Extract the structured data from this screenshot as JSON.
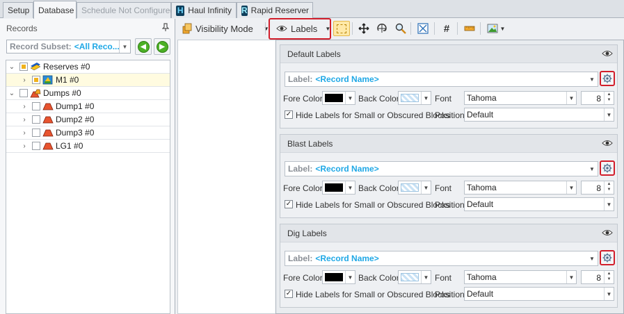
{
  "tabs": [
    {
      "label": "Setup"
    },
    {
      "label": "Database"
    },
    {
      "label": "Schedule Not Configured"
    },
    {
      "label": "Haul Infinity",
      "icon": "haul-infinity-icon"
    },
    {
      "label": "Rapid Reserver",
      "icon": "rapid-reserver-icon"
    }
  ],
  "records_panel": {
    "title": "Records",
    "subset_label": "Record Subset:",
    "subset_value": "<All Reco...",
    "tree": [
      {
        "label": "Reserves #0",
        "expanded": true,
        "checkbox": "partial",
        "icon": "reserves-icon"
      },
      {
        "label": "M1 #0",
        "checkbox": "partial",
        "icon": "model-icon"
      },
      {
        "label": "Dumps #0",
        "expanded": true,
        "checkbox": "empty",
        "icon": "dumps-icon"
      },
      {
        "label": "Dump1 #0",
        "checkbox": "empty",
        "icon": "dump-shape-icon"
      },
      {
        "label": "Dump2 #0",
        "checkbox": "empty",
        "icon": "dump-shape-icon"
      },
      {
        "label": "Dump3 #0",
        "checkbox": "empty",
        "icon": "dump-shape-icon"
      },
      {
        "label": "LG1 #0",
        "checkbox": "empty",
        "icon": "dump-shape-icon"
      }
    ]
  },
  "toolbar": {
    "visibility_mode": "Visibility Mode",
    "labels": "Labels"
  },
  "label_groups": [
    {
      "title": "Default Labels",
      "label_prefix": "Label:",
      "label_value": "<Record Name>",
      "fore_color_label": "Fore Color",
      "back_color_label": "Back Color",
      "font_label": "Font",
      "font_value": "Tahoma",
      "font_size": "8",
      "hide_label": "Hide Labels for Small or Obscured Blocks",
      "hide_checked": true,
      "position_label": "Position",
      "position_value": "Default"
    },
    {
      "title": "Blast Labels",
      "label_prefix": "Label:",
      "label_value": "<Record Name>",
      "fore_color_label": "Fore Color",
      "back_color_label": "Back Color",
      "font_label": "Font",
      "font_value": "Tahoma",
      "font_size": "8",
      "hide_label": "Hide Labels for Small or Obscured Blocks",
      "hide_checked": true,
      "position_label": "Position",
      "position_value": "Default"
    },
    {
      "title": "Dig Labels",
      "label_prefix": "Label:",
      "label_value": "<Record Name>",
      "fore_color_label": "Fore Color",
      "back_color_label": "Back Color",
      "font_label": "Font",
      "font_value": "Tahoma",
      "font_size": "8",
      "hide_label": "Hide Labels for Small or Obscured Blocks",
      "hide_checked": true,
      "position_label": "Position",
      "position_value": "Default"
    }
  ],
  "colors": {
    "highlight_red": "#d21e2b",
    "link_blue": "#1fa8e6",
    "fore_color": "#000000"
  }
}
